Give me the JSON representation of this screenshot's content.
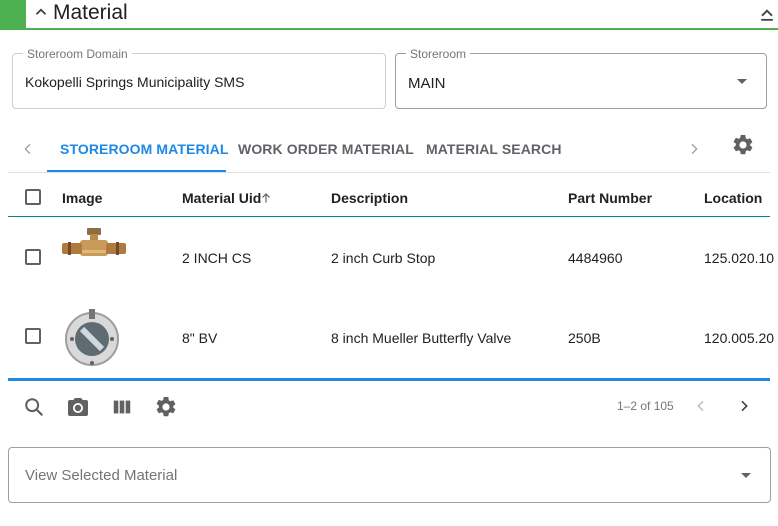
{
  "section": {
    "title": "Material"
  },
  "fields": {
    "storeroom_domain": {
      "label": "Storeroom Domain",
      "value": "Kokopelli Springs Municipality SMS"
    },
    "storeroom": {
      "label": "Storeroom",
      "value": "MAIN"
    }
  },
  "tabs": [
    {
      "label": "STOREROOM MATERIAL",
      "active": true
    },
    {
      "label": "WORK ORDER MATERIAL",
      "active": false
    },
    {
      "label": "MATERIAL SEARCH",
      "active": false
    }
  ],
  "table": {
    "columns": [
      "Image",
      "Material Uid",
      "Description",
      "Part Number",
      "Location"
    ],
    "rows": [
      {
        "uid": "2 INCH CS",
        "description": "2 inch Curb Stop",
        "part_number": "4484960",
        "location": "125.020.10"
      },
      {
        "uid": "8\" BV",
        "description": "8 inch Mueller Butterfly Valve",
        "part_number": "250B",
        "location": "120.005.20"
      }
    ]
  },
  "pager": {
    "text": "1–2 of 105"
  },
  "view_selected": {
    "placeholder": "View Selected Material"
  },
  "icons": {
    "toolbar": [
      "search-icon",
      "camera-icon",
      "columns-icon",
      "gear-icon"
    ],
    "tabs": [
      "chevron-left-icon",
      "chevron-right-icon",
      "gear-icon"
    ]
  },
  "colors": {
    "accent": "#4caf50",
    "primary": "#1e88e5",
    "header_rule": "#00897b"
  }
}
